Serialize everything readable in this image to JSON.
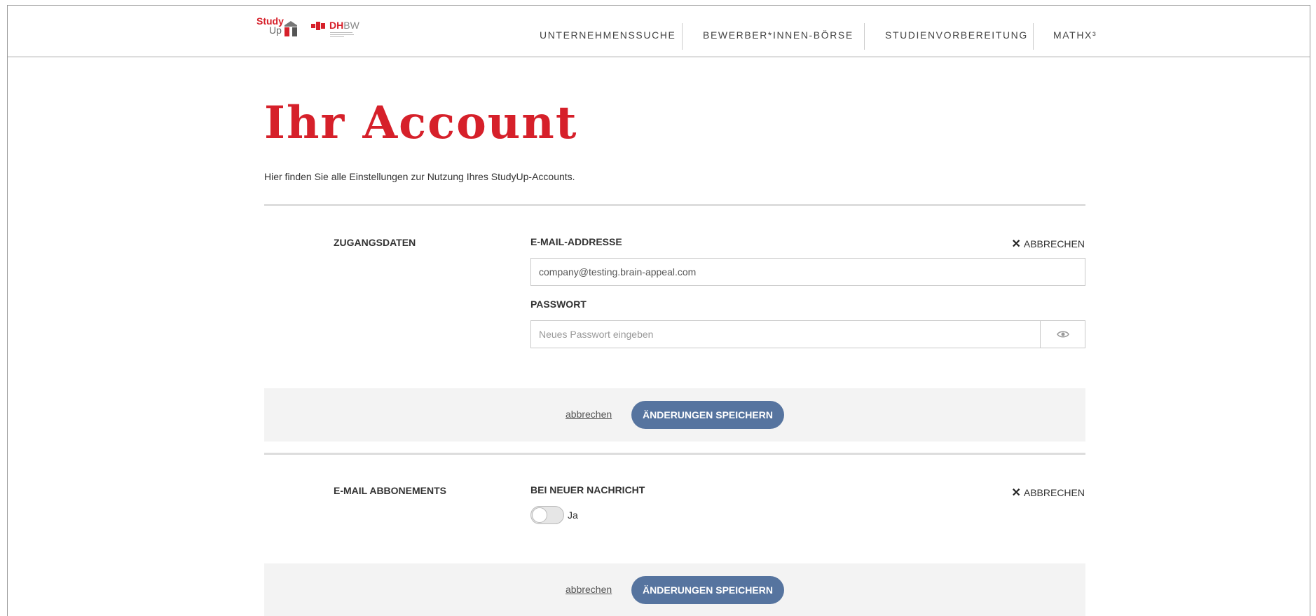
{
  "header": {
    "logo_study": "Study",
    "logo_up": "Up",
    "logo_dh": "DH",
    "logo_bw": "BW",
    "nav": [
      {
        "label": "UNTERNEHMENSSUCHE"
      },
      {
        "label": "BEWERBER*INNEN-BÖRSE"
      },
      {
        "label": "STUDIENVORBEREITUNG"
      },
      {
        "label": "MATHX³"
      }
    ]
  },
  "page": {
    "title": "Ihr Account",
    "intro": "Hier finden Sie alle Einstellungen zur Nutzung Ihres StudyUp-Accounts."
  },
  "access": {
    "section_label": "ZUGANGSDATEN",
    "email_label": "E-MAIL-ADDRESSE",
    "email_value": "company@testing.brain-appeal.com",
    "password_label": "PASSWORT",
    "password_placeholder": "Neues Passwort eingeben",
    "cancel_top": "ABBRECHEN",
    "cancel_link": "abbrechen",
    "save_label": "ÄNDERUNGEN SPEICHERN"
  },
  "subscriptions": {
    "section_label": "E-MAIL ABBONEMENTS",
    "field_label": "BEI NEUER NACHRICHT",
    "toggle_label": "Ja",
    "toggle_on": false,
    "cancel_top": "ABBRECHEN",
    "cancel_link": "abbrechen",
    "save_label": "ÄNDERUNGEN SPEICHERN"
  },
  "colors": {
    "brand_red": "#d6202a",
    "button_blue": "#56749f",
    "bar_grey": "#f3f3f3"
  }
}
